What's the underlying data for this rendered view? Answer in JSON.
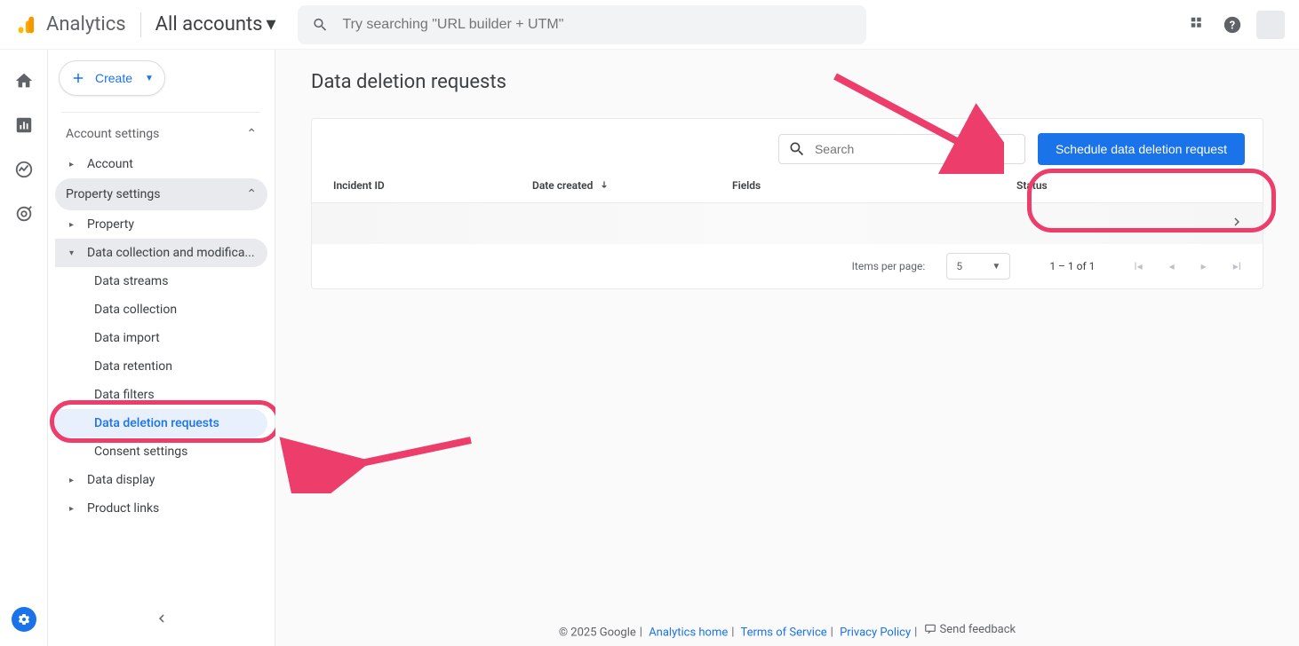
{
  "header": {
    "brand": "Analytics",
    "account_picker": "All accounts",
    "search_placeholder": "Try searching \"URL builder + UTM\""
  },
  "create_button": "Create",
  "sidebar": {
    "account_settings": "Account settings",
    "account": "Account",
    "property_settings": "Property settings",
    "property": "Property",
    "data_collection_mod": "Data collection and modifica...",
    "subs": {
      "data_streams": "Data streams",
      "data_collection": "Data collection",
      "data_import": "Data import",
      "data_retention": "Data retention",
      "data_filters": "Data filters",
      "data_deletion_requests": "Data deletion requests",
      "consent_settings": "Consent settings"
    },
    "data_display": "Data display",
    "product_links": "Product links"
  },
  "page": {
    "title": "Data deletion requests",
    "search_placeholder": "Search",
    "schedule_btn": "Schedule data deletion request",
    "cols": {
      "incident": "Incident ID",
      "date": "Date created",
      "fields": "Fields",
      "status": "Status"
    },
    "ipp_label": "Items per page:",
    "ipp_value": "5",
    "range": "1 – 1 of 1"
  },
  "footer": {
    "copyright": "© 2025 Google",
    "analytics_home": "Analytics home",
    "tos": "Terms of Service",
    "privacy": "Privacy Policy",
    "feedback": "Send feedback"
  }
}
